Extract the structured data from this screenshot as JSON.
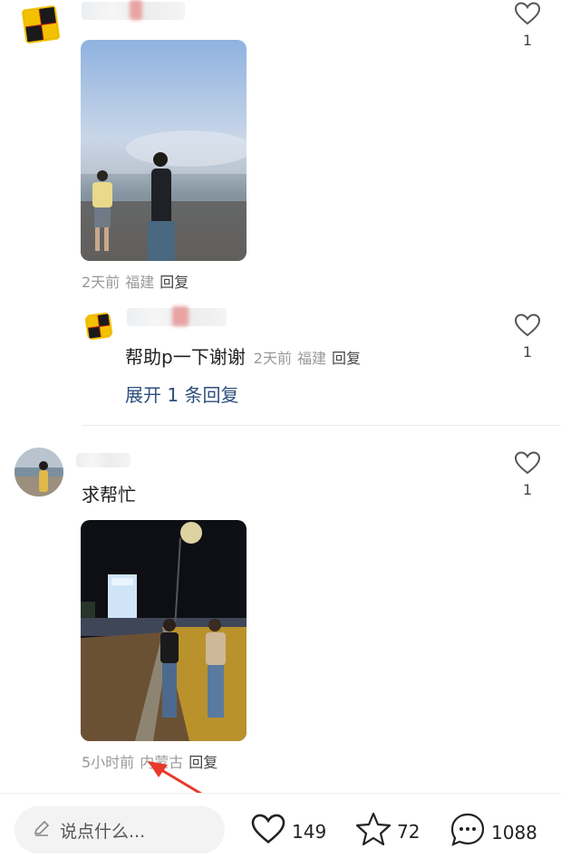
{
  "comments": [
    {
      "like_count": "1",
      "meta": {
        "time": "2天前",
        "location": "福建",
        "reply": "回复"
      },
      "reply": {
        "text": "帮助p一下谢谢",
        "time": "2天前",
        "location": "福建",
        "reply": "回复",
        "like_count": "1"
      },
      "expand_label": "展开 1 条回复"
    },
    {
      "text": "求帮忙",
      "like_count": "1",
      "meta": {
        "time": "5小时前",
        "location": "内蒙古",
        "reply": "回复"
      }
    }
  ],
  "bottom_bar": {
    "input_placeholder": "说点什么...",
    "likes": "149",
    "favorites": "72",
    "comments": "1088"
  },
  "colors": {
    "annotation_arrow": "#e8392b",
    "link": "#2e4e7e"
  }
}
